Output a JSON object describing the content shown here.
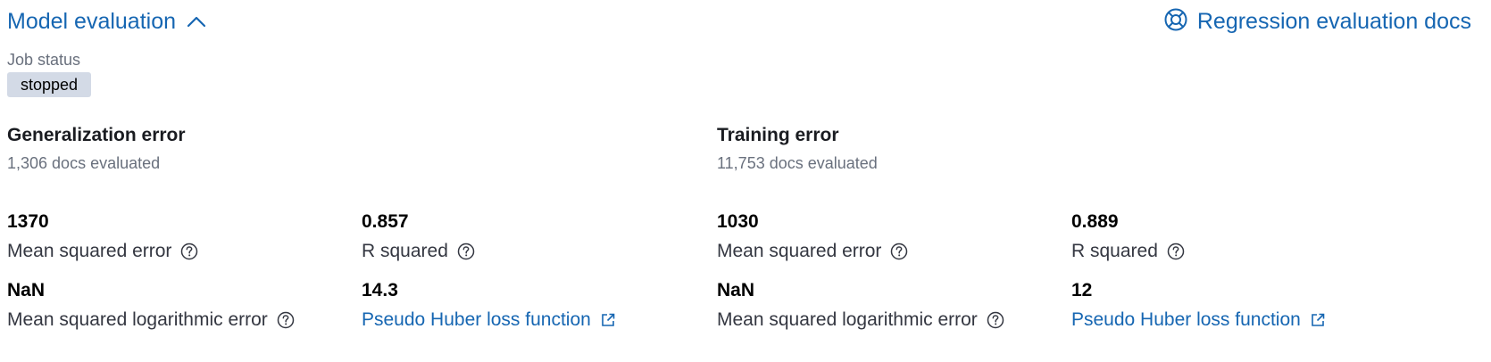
{
  "header": {
    "title": "Model evaluation",
    "docs_link": "Regression evaluation docs"
  },
  "job_status": {
    "label": "Job status",
    "value": "stopped"
  },
  "generalization": {
    "title": "Generalization error",
    "docs_evaluated": "1,306 docs evaluated",
    "metrics": [
      {
        "value": "1370",
        "label": "Mean squared error"
      },
      {
        "value": "0.857",
        "label": "R squared"
      },
      {
        "value": "NaN",
        "label": "Mean squared logarithmic error"
      },
      {
        "value": "14.3",
        "label": "Pseudo Huber loss function"
      }
    ]
  },
  "training": {
    "title": "Training error",
    "docs_evaluated": "11,753 docs evaluated",
    "metrics": [
      {
        "value": "1030",
        "label": "Mean squared error"
      },
      {
        "value": "0.889",
        "label": "R squared"
      },
      {
        "value": "NaN",
        "label": "Mean squared logarithmic error"
      },
      {
        "value": "12",
        "label": "Pseudo Huber loss function"
      }
    ]
  },
  "colors": {
    "link": "#1666b2",
    "badge_bg": "#d3dae6",
    "subdued_text": "#69707d"
  }
}
